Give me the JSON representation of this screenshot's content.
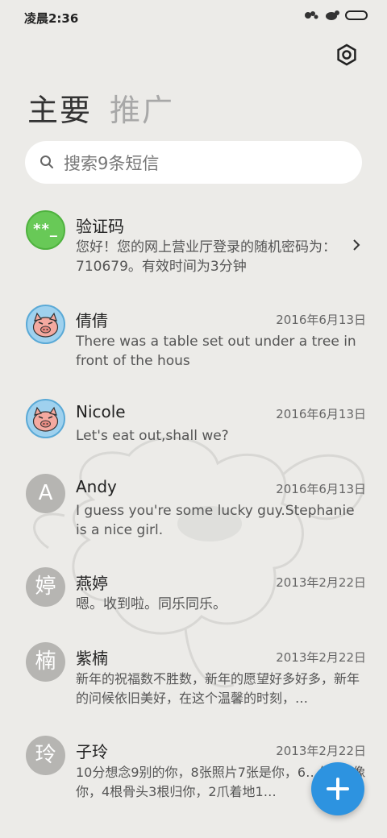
{
  "status": {
    "time": "凌晨2:36"
  },
  "tabs": [
    {
      "label": "主要",
      "active": true
    },
    {
      "label": "推广",
      "active": false
    }
  ],
  "search": {
    "placeholder": "搜索9条短信"
  },
  "messages": [
    {
      "name": "验证码",
      "date": "",
      "preview": "您好！您的网上营业厅登录的随机密码为：710679。有效时间为3分钟",
      "avatar_text": "**_",
      "avatar_type": "green"
    },
    {
      "name": "倩倩",
      "date": "2016年6月13日",
      "preview": "There was a table set out under a tree in front of the hous",
      "avatar_type": "pig"
    },
    {
      "name": "Nicole",
      "date": "2016年6月13日",
      "preview": "Let's eat out,shall we?",
      "avatar_type": "pig"
    },
    {
      "name": "Andy",
      "date": "2016年6月13日",
      "preview": "I guess you're some lucky guy.Stephanie is a nice girl.",
      "avatar_text": "A",
      "avatar_type": "letter"
    },
    {
      "name": "燕婷",
      "date": "2013年2月22日",
      "preview": "嗯。收到啦。同乐同乐。",
      "avatar_text": "婷",
      "avatar_type": "letter"
    },
    {
      "name": "紫楠",
      "date": "2013年2月22日",
      "preview": "新年的祝福数不胜数，新年的愿望好多好多，新年的问候依旧美好，在这个温馨的时刻，…",
      "avatar_text": "楠",
      "avatar_type": "letter"
    },
    {
      "name": "子玲",
      "date": "2013年2月22日",
      "preview": "10分想念9别的你，8张照片7张是你，6…你5只像你，4根骨头3根归你，2爪着地1…",
      "avatar_text": "玲",
      "avatar_type": "letter"
    }
  ],
  "colors": {
    "accent": "#2d93e0",
    "verify_avatar": "#68c957",
    "pig_avatar_bg": "#9fd1ee",
    "letter_avatar": "#b6b5b2"
  }
}
